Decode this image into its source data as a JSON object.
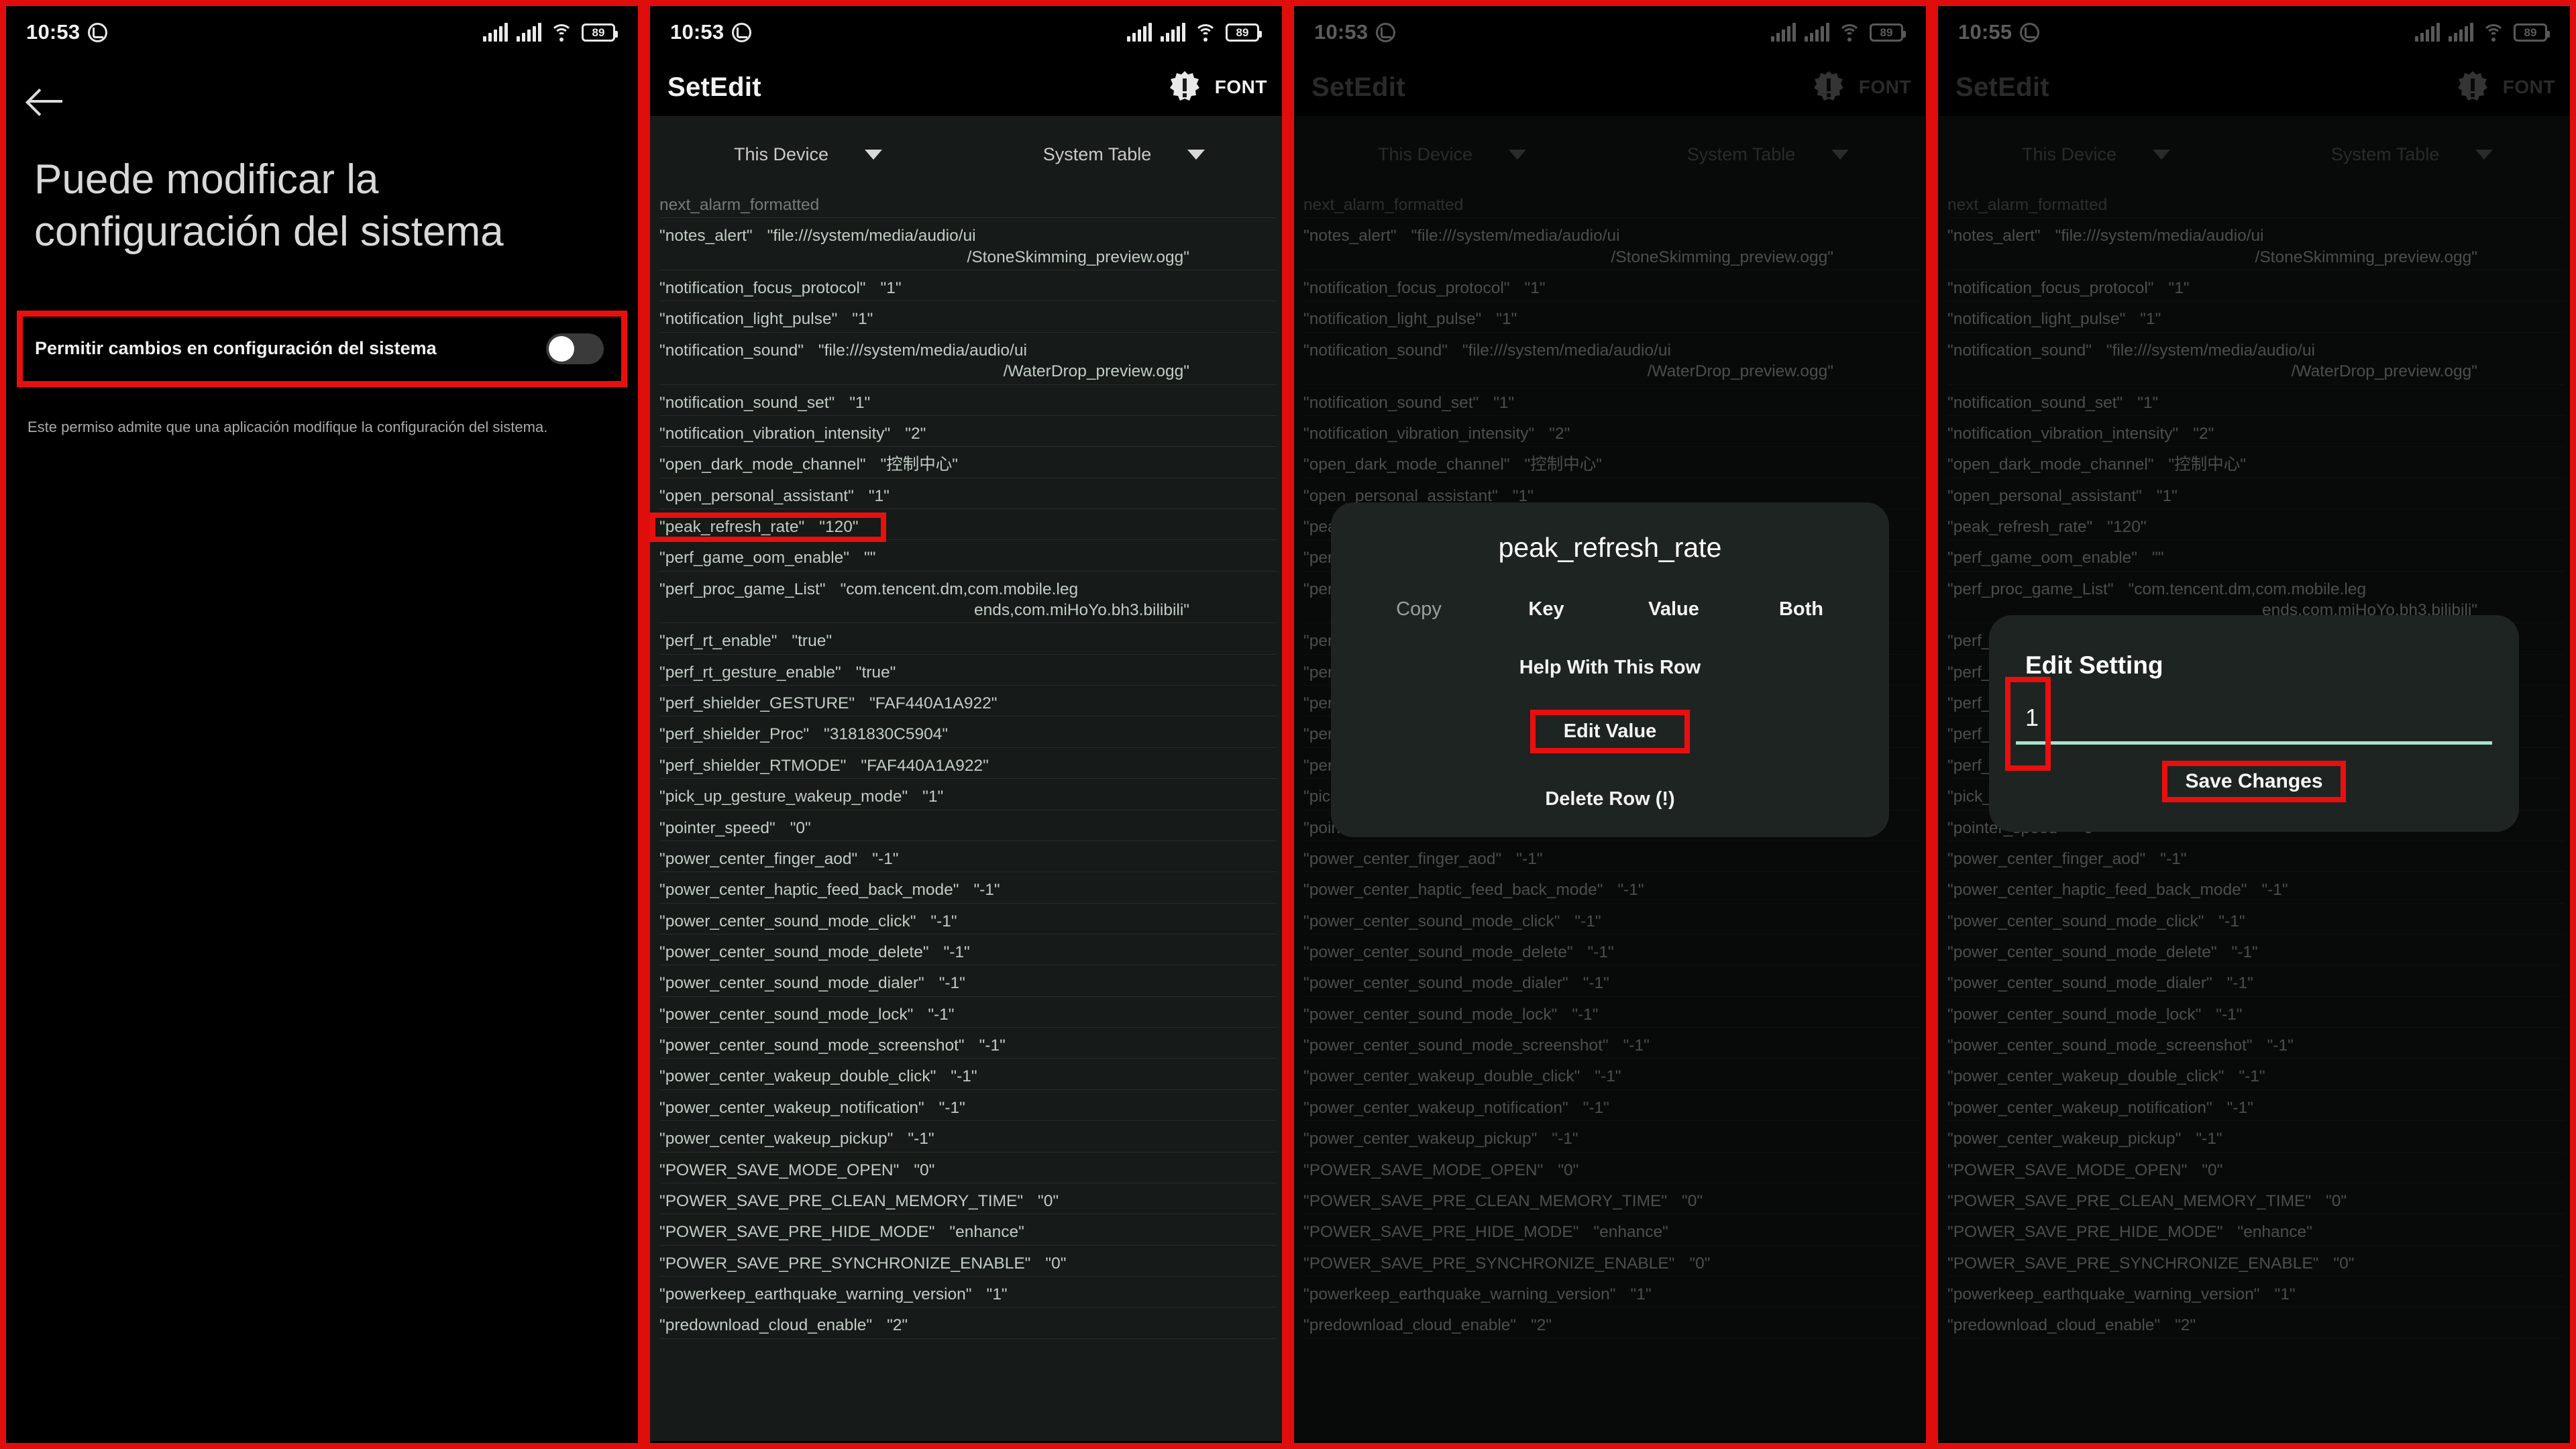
{
  "panels": {
    "p1": {
      "statusbar": {
        "time": "10:53",
        "battery": "89",
        "whatsapp_icon": "whatsapp-icon",
        "wifi_icon": "wifi-icon",
        "signal_icon": "signal-bars-icon",
        "battery_icon": "battery-icon"
      },
      "back_icon": "back-arrow-icon",
      "title": "Puede modificar la configuración del sistema",
      "permission_label": "Permitir cambios en configuración del sistema",
      "toggle_state": "off",
      "description": "Este permiso admite que una aplicación modifique la configuración del sistema."
    },
    "p2": {
      "statusbar": {
        "time": "10:53",
        "battery": "89"
      },
      "app_title": "SetEdit",
      "font_button": "FONT",
      "warning_icon": "warning-badge-icon",
      "select_device": "This Device",
      "select_table": "System Table",
      "highlight_key": "peak_refresh_rate"
    },
    "p3": {
      "statusbar": {
        "time": "10:53",
        "battery": "89"
      },
      "app_title": "SetEdit",
      "font_button": "FONT",
      "dialog": {
        "title": "peak_refresh_rate",
        "copy_label": "Copy",
        "actions": [
          "Key",
          "Value",
          "Both"
        ],
        "help_label": "Help With This Row",
        "edit_value_label": "Edit Value",
        "delete_label": "Delete Row (!)"
      }
    },
    "p4": {
      "statusbar": {
        "time": "10:55",
        "battery": "89"
      },
      "app_title": "SetEdit",
      "font_button": "FONT",
      "dialog": {
        "title": "Edit Setting",
        "input_value": "1",
        "save_label": "Save Changes"
      }
    }
  },
  "settings_rows": [
    {
      "key": "next_alarm_formatted",
      "value": "",
      "partial": true
    },
    {
      "key": "\"notes_alert\"",
      "value": "\"file:///system/media/audio/ui",
      "cont": "/StoneSkimming_preview.ogg\""
    },
    {
      "key": "\"notification_focus_protocol\"",
      "value": "\"1\""
    },
    {
      "key": "\"notification_light_pulse\"",
      "value": "\"1\""
    },
    {
      "key": "\"notification_sound\"",
      "value": "\"file:///system/media/audio/ui",
      "cont": "/WaterDrop_preview.ogg\""
    },
    {
      "key": "\"notification_sound_set\"",
      "value": "\"1\""
    },
    {
      "key": "\"notification_vibration_intensity\"",
      "value": "\"2\""
    },
    {
      "key": "\"open_dark_mode_channel\"",
      "value": "\"控制中心\""
    },
    {
      "key": "\"open_personal_assistant\"",
      "value": "\"1\""
    },
    {
      "key": "\"peak_refresh_rate\"",
      "value": "\"120\"",
      "highlight": true
    },
    {
      "key": "\"perf_game_oom_enable\"",
      "value": "\"\""
    },
    {
      "key": "\"perf_proc_game_List\"",
      "value": "\"com.tencent.dm,com.mobile.leg",
      "cont": "ends,com.miHoYo.bh3.bilibili\""
    },
    {
      "key": "\"perf_rt_enable\"",
      "value": "\"true\""
    },
    {
      "key": "\"perf_rt_gesture_enable\"",
      "value": "\"true\""
    },
    {
      "key": "\"perf_shielder_GESTURE\"",
      "value": "\"FAF440A1A922\""
    },
    {
      "key": "\"perf_shielder_Proc\"",
      "value": "\"3181830C5904\""
    },
    {
      "key": "\"perf_shielder_RTMODE\"",
      "value": "\"FAF440A1A922\""
    },
    {
      "key": "\"pick_up_gesture_wakeup_mode\"",
      "value": "\"1\""
    },
    {
      "key": "\"pointer_speed\"",
      "value": "\"0\""
    },
    {
      "key": "\"power_center_finger_aod\"",
      "value": "\"-1\""
    },
    {
      "key": "\"power_center_haptic_feed_back_mode\"",
      "value": "\"-1\""
    },
    {
      "key": "\"power_center_sound_mode_click\"",
      "value": "\"-1\""
    },
    {
      "key": "\"power_center_sound_mode_delete\"",
      "value": "\"-1\""
    },
    {
      "key": "\"power_center_sound_mode_dialer\"",
      "value": "\"-1\""
    },
    {
      "key": "\"power_center_sound_mode_lock\"",
      "value": "\"-1\""
    },
    {
      "key": "\"power_center_sound_mode_screenshot\"",
      "value": "\"-1\""
    },
    {
      "key": "\"power_center_wakeup_double_click\"",
      "value": "\"-1\""
    },
    {
      "key": "\"power_center_wakeup_notification\"",
      "value": "\"-1\""
    },
    {
      "key": "\"power_center_wakeup_pickup\"",
      "value": "\"-1\""
    },
    {
      "key": "\"POWER_SAVE_MODE_OPEN\"",
      "value": "\"0\""
    },
    {
      "key": "\"POWER_SAVE_PRE_CLEAN_MEMORY_TIME\"",
      "value": "\"0\""
    },
    {
      "key": "\"POWER_SAVE_PRE_HIDE_MODE\"",
      "value": "\"enhance\""
    },
    {
      "key": "\"POWER_SAVE_PRE_SYNCHRONIZE_ENABLE\"",
      "value": "\"0\""
    },
    {
      "key": "\"powerkeep_earthquake_warning_version\"",
      "value": "\"1\""
    },
    {
      "key": "\"predownload_cloud_enable\"",
      "value": "\"2\""
    }
  ],
  "colors": {
    "accent_red": "#e90f0f",
    "list_bg": "#161a18",
    "text": "#c2ccc5",
    "underline": "#a9e3cc"
  }
}
